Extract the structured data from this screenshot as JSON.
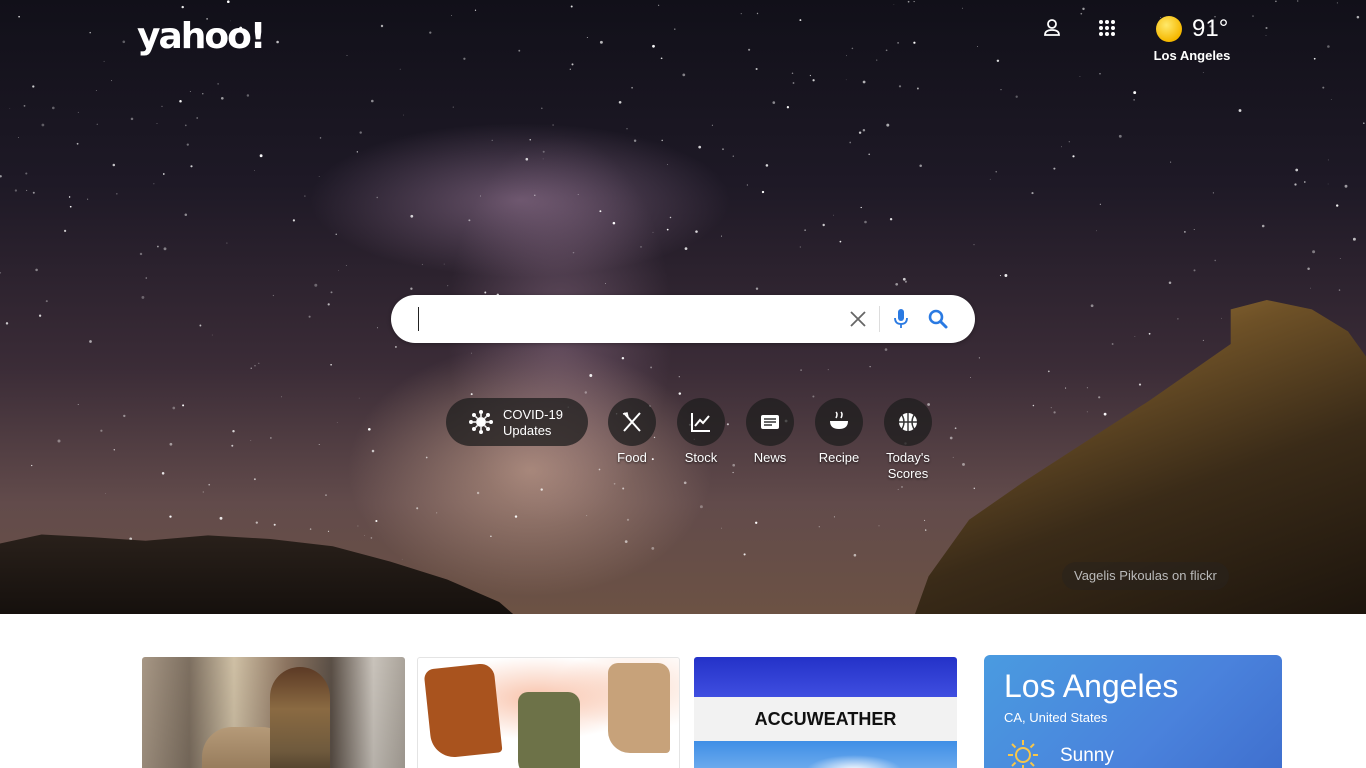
{
  "brand": {
    "logo_text": "yahoo!"
  },
  "weather": {
    "temperature": "91°",
    "city": "Los Angeles",
    "icon": "sun-icon"
  },
  "search": {
    "value": "",
    "placeholder": ""
  },
  "shortcuts": {
    "covid": {
      "line1": "COVID-19",
      "line2": "Updates"
    },
    "items": [
      {
        "label": "Food",
        "icon": "fork-knife-icon"
      },
      {
        "label": "Stock",
        "icon": "chart-line-icon"
      },
      {
        "label": "News",
        "icon": "newspaper-icon"
      },
      {
        "label": "Recipe",
        "icon": "bowl-icon"
      },
      {
        "label": "Today's Scores",
        "icon": "basketball-icon"
      }
    ]
  },
  "credit": "Vagelis Pikoulas on flickr",
  "cards": {
    "accuweather": {
      "label": "ACCUWEATHER"
    }
  },
  "weather_card": {
    "city": "Los Angeles",
    "region": "CA, United States",
    "condition": "Sunny"
  },
  "colors": {
    "weather_card": "#4a8adf",
    "search_accent": "#2a7ae2"
  }
}
